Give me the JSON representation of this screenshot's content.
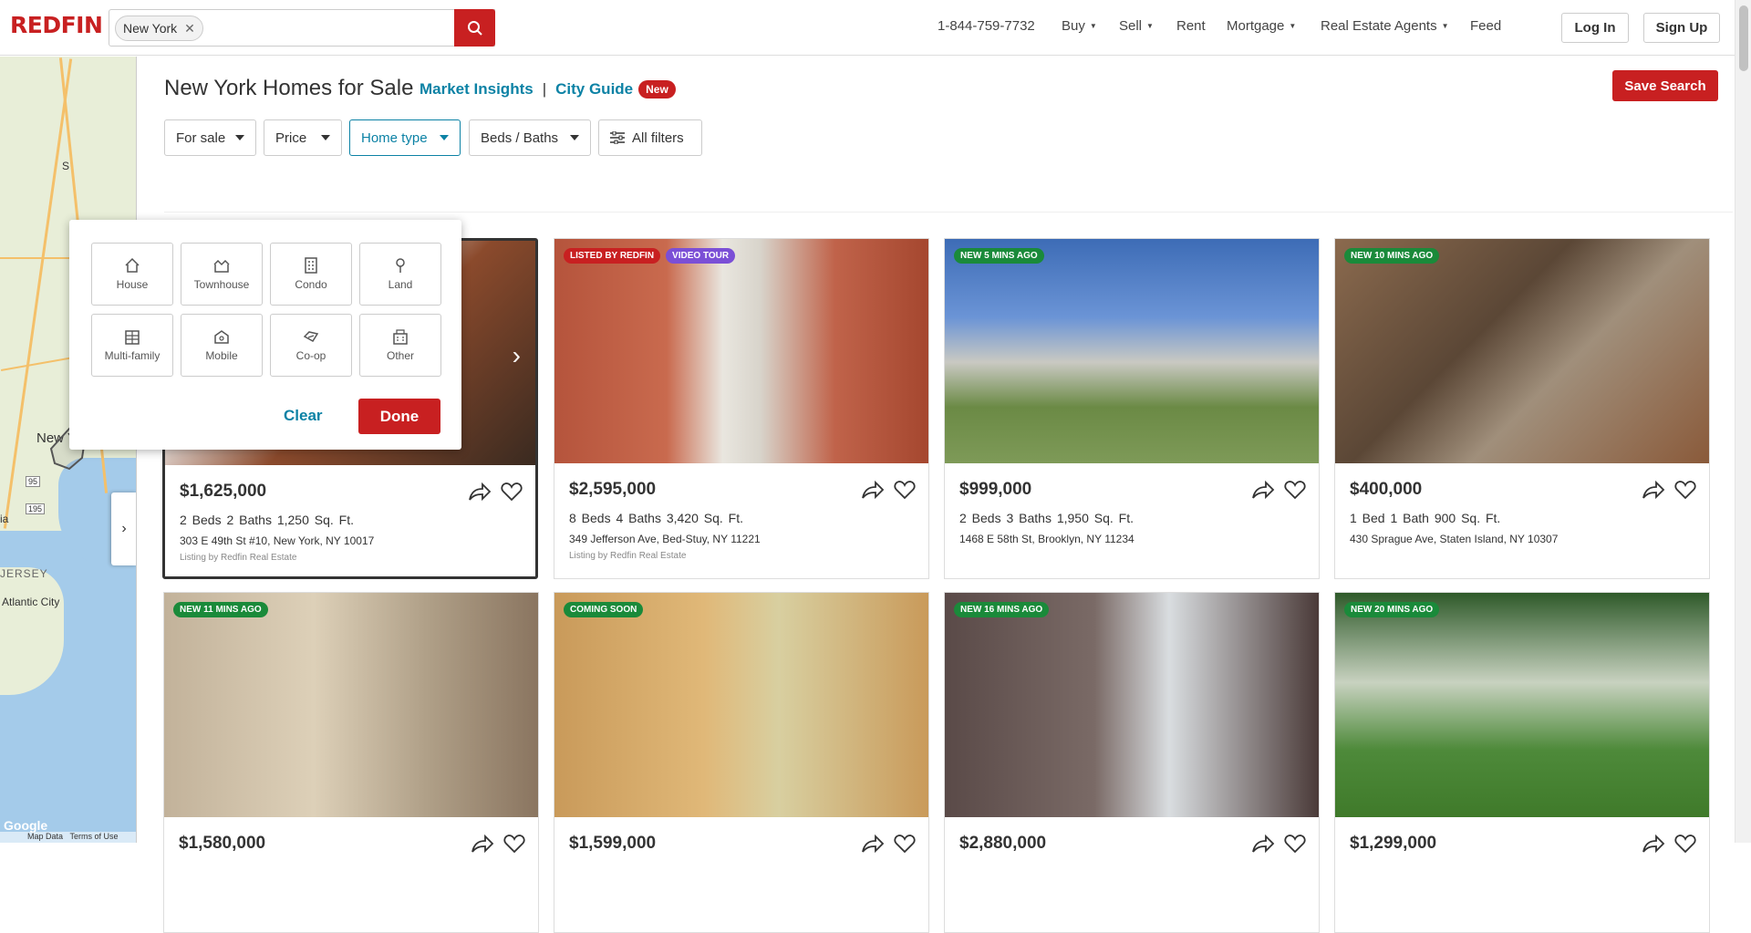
{
  "header": {
    "logo": "REDFIN",
    "search_chip": "New York",
    "phone": "1-844-759-7732",
    "nav": [
      {
        "label": "Buy",
        "caret": true
      },
      {
        "label": "Sell",
        "caret": true
      },
      {
        "label": "Rent",
        "caret": false
      },
      {
        "label": "Mortgage",
        "caret": true
      },
      {
        "label": "Real Estate Agents",
        "caret": true
      },
      {
        "label": "Feed",
        "caret": false
      }
    ],
    "login": "Log In",
    "signup": "Sign Up"
  },
  "map": {
    "labels": [
      "New York",
      "Atlantic City",
      "JERSEY",
      "Google",
      "Map Data",
      "Terms of Use",
      "S",
      "ia"
    ],
    "highways": [
      "95",
      "195"
    ]
  },
  "page": {
    "title": "New York Homes for Sale",
    "market_insights": "Market Insights",
    "separator": "|",
    "city_guide": "City Guide",
    "new_badge": "New",
    "save_search": "Save Search"
  },
  "filters": {
    "for_sale": "For sale",
    "price": "Price",
    "home_type": "Home type",
    "beds_baths": "Beds / Baths",
    "all_filters": "All filters"
  },
  "home_type_menu": {
    "options": [
      "House",
      "Townhouse",
      "Condo",
      "Land",
      "Multi-family",
      "Mobile",
      "Co-op",
      "Other"
    ],
    "clear": "Clear",
    "done": "Done"
  },
  "listings": [
    {
      "badges": [],
      "price": "$1,625,000",
      "stats": "2 Beds  2 Baths  1,250 Sq. Ft.",
      "address": "303 E 49th St #10, New York, NY 10017",
      "listing_by": "Listing by Redfin Real Estate"
    },
    {
      "badges": [
        {
          "text": "LISTED BY REDFIN",
          "color": "#c82021"
        },
        {
          "text": "VIDEO TOUR",
          "color": "#7b4fd6"
        }
      ],
      "price": "$2,595,000",
      "stats": "8 Beds  4 Baths  3,420 Sq. Ft.",
      "address": "349 Jefferson Ave, Bed-Stuy, NY 11221",
      "listing_by": "Listing by Redfin Real Estate"
    },
    {
      "badges": [
        {
          "text": "NEW 5 MINS AGO",
          "color": "#1a8a3a"
        }
      ],
      "price": "$999,000",
      "stats": "2 Beds  3 Baths  1,950 Sq. Ft.",
      "address": "1468 E 58th St, Brooklyn, NY 11234",
      "listing_by": ""
    },
    {
      "badges": [
        {
          "text": "NEW 10 MINS AGO",
          "color": "#1a8a3a"
        }
      ],
      "price": "$400,000",
      "stats": "1 Bed  1 Bath  900 Sq. Ft.",
      "address": "430 Sprague Ave, Staten Island, NY 10307",
      "listing_by": ""
    },
    {
      "badges": [
        {
          "text": "NEW 11 MINS AGO",
          "color": "#1a8a3a"
        }
      ],
      "price": "$1,580,000",
      "stats": "",
      "address": "",
      "listing_by": ""
    },
    {
      "badges": [
        {
          "text": "COMING SOON",
          "color": "#1a8a3a"
        }
      ],
      "price": "$1,599,000",
      "stats": "",
      "address": "",
      "listing_by": ""
    },
    {
      "badges": [
        {
          "text": "NEW 16 MINS AGO",
          "color": "#1a8a3a"
        }
      ],
      "price": "$2,880,000",
      "stats": "",
      "address": "",
      "listing_by": ""
    },
    {
      "badges": [
        {
          "text": "NEW 20 MINS AGO",
          "color": "#1a8a3a"
        }
      ],
      "price": "$1,299,000",
      "stats": "",
      "address": "",
      "listing_by": ""
    }
  ],
  "colors": {
    "brand_red": "#c82021",
    "link_blue": "#0c82a5"
  }
}
